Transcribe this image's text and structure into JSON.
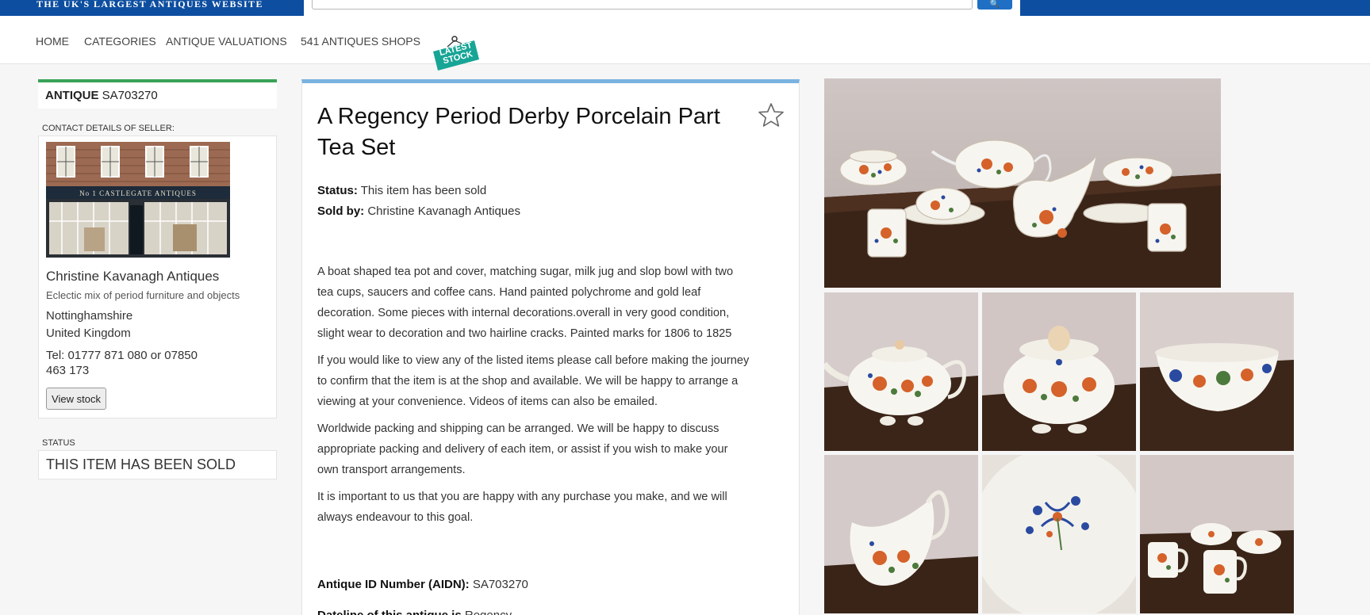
{
  "header": {
    "tagline": "THE UK'S LARGEST ANTIQUES WEBSITE",
    "search_placeholder": "",
    "search_button_icon": "search-icon",
    "brand_color": "#0d4ea0"
  },
  "nav": {
    "items": [
      "HOME",
      "CATEGORIES",
      "ANTIQUE VALUATIONS",
      "541 ANTIQUES SHOPS"
    ],
    "latest_stock": "LATEST STOCK"
  },
  "sidebar": {
    "antique_label": "ANTIQUE",
    "antique_id": "SA703270",
    "contact_label": "CONTACT DETAILS OF SELLER:",
    "shop_sign": "No 1 CASTLEGATE ANTIQUES",
    "seller_name": "Christine Kavanagh Antiques",
    "seller_description": "Eclectic mix of period furniture and objects",
    "county": "Nottinghamshire",
    "country": "United Kingdom",
    "telephone": "Tel: 01777 871 080 or 07850 463 173",
    "view_stock_label": "View stock",
    "status_label": "STATUS",
    "status_value": "THIS ITEM HAS BEEN SOLD"
  },
  "main": {
    "title": "A Regency Period Derby Porcelain Part Tea Set",
    "status_label": "Status:",
    "status_value": "This item has been sold",
    "sold_by_label": "Sold by:",
    "sold_by_value": "Christine Kavanagh Antiques",
    "paragraphs": [
      "A boat shaped tea pot and cover, matching sugar, milk jug and slop bowl with two tea cups, saucers and coffee cans. Hand painted polychrome and gold leaf decoration. Some pieces with internal decorations.overall in very good condition, slight wear to decoration and two hairline cracks. Painted marks for 1806 to 1825",
      "If you would like to view any of the listed items please call before making the journey to confirm that the item is at the shop and available. We will be happy to arrange a viewing at your convenience. Videos of items can also be emailed.",
      "Worldwide packing and shipping can be arranged. We will be happy to discuss appropriate packing and delivery of each item, or assist if you wish to make your own transport arrangements.",
      "It is important to us that you are happy with any purchase you make, and we will always endeavour to this goal."
    ],
    "aidn_label": "Antique ID Number (AIDN):",
    "aidn_value": "SA703270",
    "dateline_label": "Dateline of this antique is",
    "dateline_value": "Regency"
  },
  "gallery": {
    "main_image": "tea-set-photo",
    "thumbnails": [
      "teapot-photo",
      "sugar-bowl-photo",
      "slop-bowl-photo",
      "milk-jug-photo",
      "bowl-interior-photo",
      "cups-and-cans-photo"
    ]
  },
  "colors": {
    "id_accent": "#38a357",
    "card_accent": "#7ab2e0",
    "latest_stock_badge": "#17a596"
  }
}
